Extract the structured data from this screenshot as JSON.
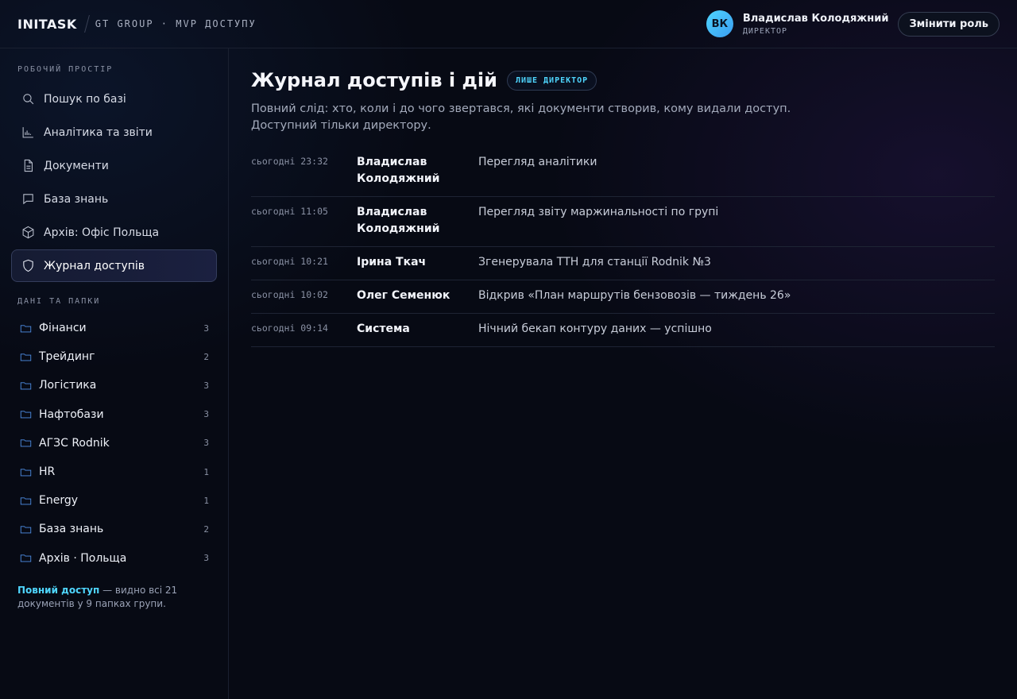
{
  "header": {
    "brand": "INITASK",
    "subtitle": "GT GROUP · MVP ДОСТУПУ",
    "user": {
      "initials": "ВК",
      "name": "Владислав Колодяжний",
      "role": "ДИРЕКТОР"
    },
    "change_role_label": "Змінити роль"
  },
  "sidebar": {
    "workspace_label": "РОБОЧИЙ ПРОСТІР",
    "nav": [
      {
        "label": "Пошук по базі",
        "icon": "search-icon"
      },
      {
        "label": "Аналітика та звіти",
        "icon": "bar-chart-icon"
      },
      {
        "label": "Документи",
        "icon": "document-icon"
      },
      {
        "label": "База знань",
        "icon": "chat-bubble-icon"
      },
      {
        "label": "Архів: Офіс Польща",
        "icon": "box-icon"
      },
      {
        "label": "Журнал доступів",
        "icon": "shield-icon",
        "active": true
      }
    ],
    "folders_label": "ДАНІ ТА ПАПКИ",
    "folders": [
      {
        "label": "Фінанси",
        "count": "3"
      },
      {
        "label": "Трейдинг",
        "count": "2"
      },
      {
        "label": "Логістика",
        "count": "3"
      },
      {
        "label": "Нафтобази",
        "count": "3"
      },
      {
        "label": "АГЗС Rodnik",
        "count": "3"
      },
      {
        "label": "HR",
        "count": "1"
      },
      {
        "label": "Energy",
        "count": "1"
      },
      {
        "label": "База знань",
        "count": "2"
      },
      {
        "label": "Архів · Польща",
        "count": "3"
      }
    ],
    "note_highlight": "Повний доступ",
    "note_text": " — видно всі 21 документів у 9 папках групи."
  },
  "main": {
    "title": "Журнал доступів і дій",
    "badge": "ЛИШЕ ДИРЕКТОР",
    "description": "Повний слід: хто, коли і до чого звертався, які документи створив, кому видали доступ. Доступний тільки директору.",
    "log": [
      {
        "time": "сьогодні 23:32",
        "who": "Владислав Колодяжний",
        "action": "Перегляд аналітики"
      },
      {
        "time": "сьогодні 11:05",
        "who": "Владислав Колодяжний",
        "action": "Перегляд звіту маржинальності по групі"
      },
      {
        "time": "сьогодні 10:21",
        "who": "Ірина Ткач",
        "action": "Згенерувала ТТН для станції Rodnik №3"
      },
      {
        "time": "сьогодні 10:02",
        "who": "Олег Семенюк",
        "action": "Відкрив «План маршрутів бензовозів — тиждень 26»"
      },
      {
        "time": "сьогодні 09:14",
        "who": "Система",
        "action": "Нічний бекап контуру даних — успішно"
      }
    ]
  },
  "colors": {
    "accent": "#4fd6ff",
    "folder": "#4f8fe8",
    "background": "#070a14"
  }
}
